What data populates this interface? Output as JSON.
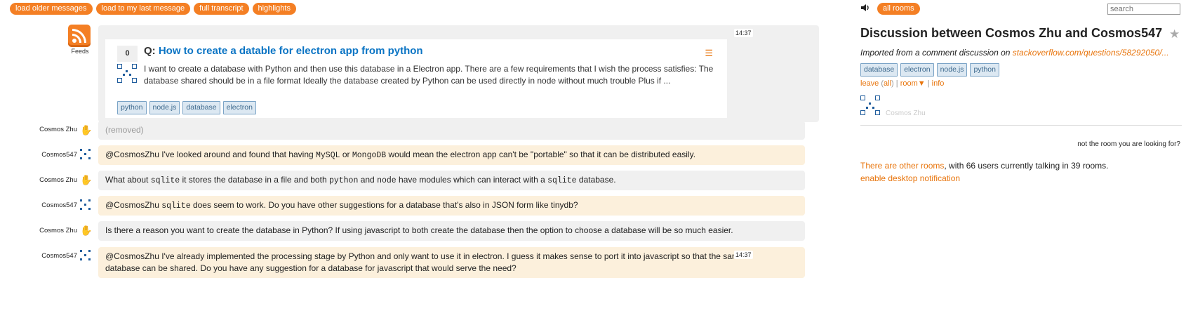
{
  "toolbar": {
    "buttons": [
      "load older messages",
      "load to my last message",
      "full transcript",
      "highlights"
    ]
  },
  "feed": {
    "label": "Feeds",
    "timestamp": "14:37",
    "question": {
      "votes": "0",
      "prefix": "Q:",
      "title": "How to create a datable for electron app from python",
      "excerpt": "I want to create a database with Python and then use this database in a Electron app. There are a few requirements that I wish the process satisfies: The database shared should be in a file format Ideally the database created by Python can be used directly in node without much trouble Plus if ...",
      "tags": [
        "python",
        "node.js",
        "database",
        "electron"
      ]
    }
  },
  "messages": [
    {
      "user": "Cosmos Zhu",
      "text": "(removed)"
    },
    {
      "user": "Cosmos547",
      "parts": [
        "@CosmosZhu I've looked around and found that having ",
        "MySQL",
        " or ",
        "MongoDB",
        " would mean the electron app can't be \"portable\" so that it can be distributed easily."
      ]
    },
    {
      "user": "Cosmos Zhu",
      "parts": [
        "What about ",
        "sqlite",
        " it stores the database in a file and both ",
        "python",
        " and ",
        "node",
        " have modules which can interact with a ",
        "sqlite",
        " database."
      ]
    },
    {
      "user": "Cosmos547",
      "parts": [
        "@CosmosZhu ",
        "sqlite",
        " does seem to work. Do you have other suggestions for a database that's also in JSON form like tinydb?"
      ]
    },
    {
      "user": "Cosmos Zhu",
      "text": "Is there a reason you want to create the database in Python? If using javascript to both create the database then the option to choose a database will be so much easier."
    },
    {
      "user": "Cosmos547",
      "timestamp": "14:37",
      "text": "@CosmosZhu I've already implemented the processing stage by Python and only want to use it in electron. I guess it makes sense to port it into javascript so that the same database can be shared. Do you have any suggestion for a database for javascript that would serve the need?"
    }
  ],
  "sidebar": {
    "all_rooms": "all rooms",
    "search_placeholder": "search",
    "room_title": "Discussion between Cosmos Zhu and Cosmos547",
    "description_prefix": "Imported from a comment discussion on ",
    "description_link": "stackoverflow.com/questions/58292050/...",
    "tags": [
      "database",
      "electron",
      "node.js",
      "python"
    ],
    "links": {
      "leave": "leave",
      "all": "all",
      "room": "room▼",
      "info": "info",
      "sep1": "|",
      "sep2": "|",
      "paren_open": "(",
      "paren_close": ")"
    },
    "member_name": "Cosmos Zhu",
    "not_room": "not the room you are looking for?",
    "other_rooms_link": "There are other rooms",
    "other_rooms_text": ", with 66 users currently talking in 39 rooms.",
    "desktop_notification": "enable desktop notification"
  },
  "colors": {
    "accent": "#f47f24",
    "link": "#0a74c4",
    "peach": "#fcf0dc",
    "grey": "#f0f0f0"
  }
}
